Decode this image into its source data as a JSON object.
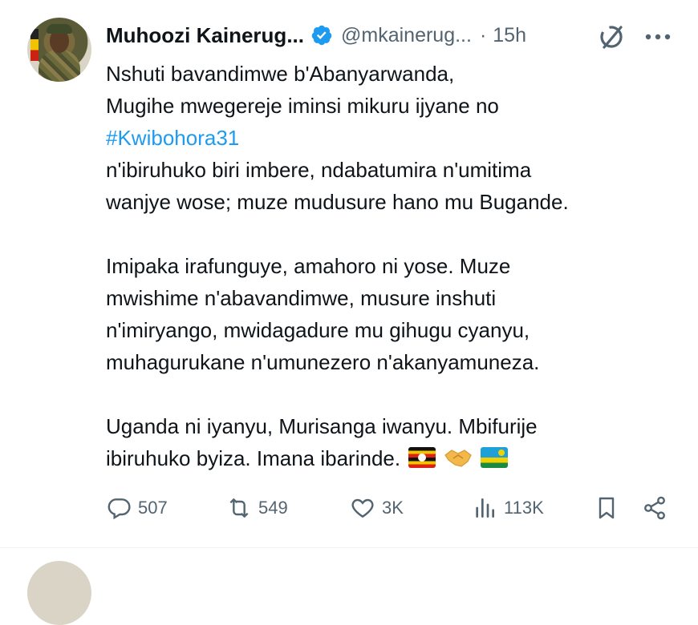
{
  "author": {
    "name": "Muhoozi Kainerug...",
    "handle": "@mkainerug...",
    "separator": "·",
    "time": "15h"
  },
  "tweet": {
    "lines": [
      "Nshuti bavandimwe b'Abanyarwanda,",
      "Mugihe mwegereje iminsi mikuru ijyane no",
      "#Kwibohora31",
      "n'ibiruhuko biri imbere, ndabatumira n'umitima",
      "wanjye wose; muze mudusure hano mu Bugande.",
      "",
      "Imipaka irafunguye, amahoro ni yose. Muze",
      "mwishime n'abavandimwe, musure inshuti",
      "n'imiryango, mwidagadure mu gihugu cyanyu,",
      "muhagurukane n'umunezero n'akanyamuneza.",
      "",
      "Uganda ni iyanyu, Murisanga iwanyu. Mbifurije",
      "ibiruhuko byiza. Imana ibarinde."
    ],
    "emojis": [
      "uganda-flag",
      "handshake",
      "rwanda-flag"
    ]
  },
  "actions": {
    "replies": "507",
    "reposts": "549",
    "likes": "3K",
    "views": "113K"
  },
  "colors": {
    "text": "#0f1419",
    "muted": "#536471",
    "link": "#1d9bf0",
    "verified": "#1d9bf0"
  }
}
